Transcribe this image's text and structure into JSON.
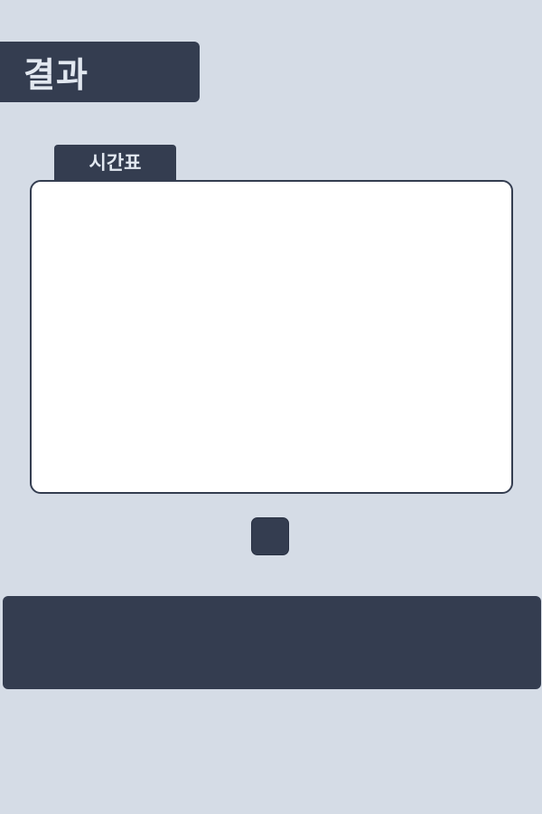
{
  "header": {
    "title": "결과"
  },
  "timetable": {
    "tab_label": "시간표"
  },
  "colors": {
    "background": "#d5dce6",
    "dark": "#343d50",
    "panel": "#ffffff",
    "text_light": "#e2e8f0"
  }
}
